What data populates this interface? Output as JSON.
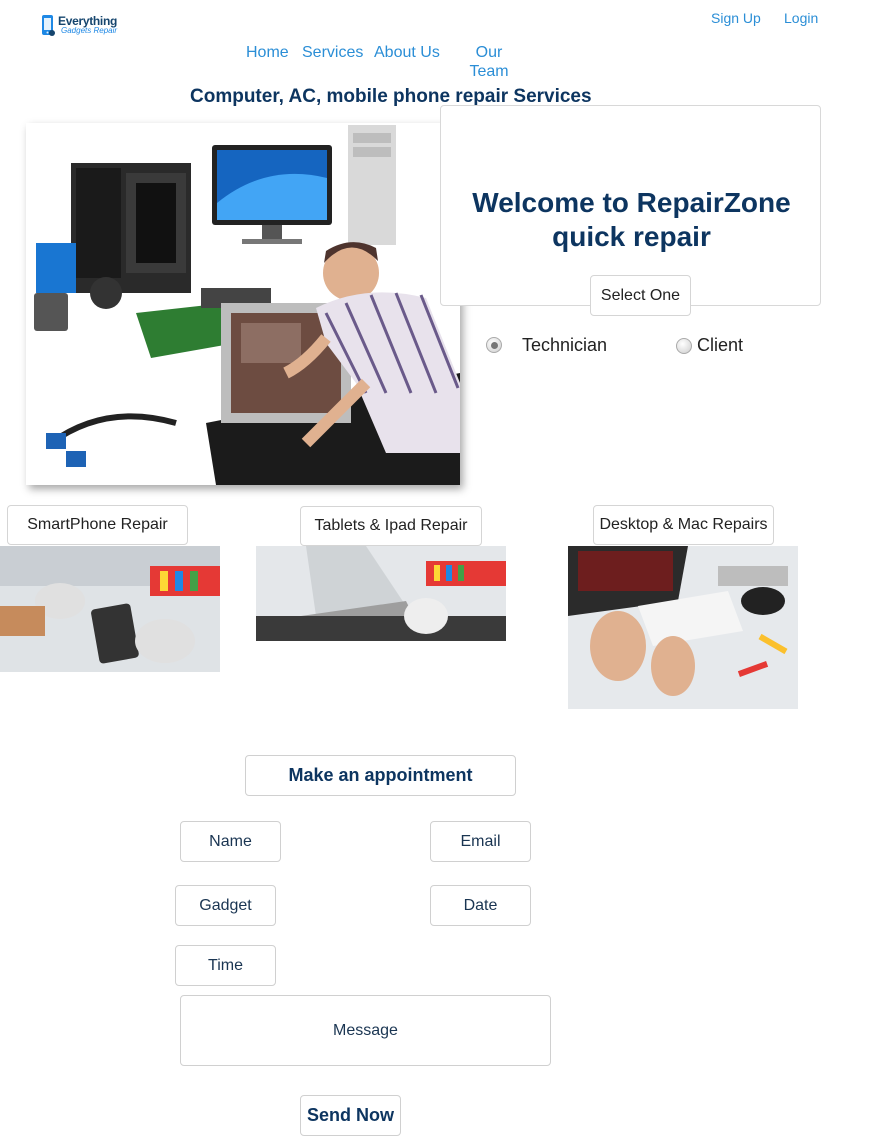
{
  "header": {
    "logo": {
      "line1": "Everything",
      "line2": "Gadgets Repair"
    },
    "signup_label": "Sign Up",
    "login_label": "Login"
  },
  "nav": {
    "home": "Home",
    "services": "Services",
    "about": "About Us",
    "team_line1": "Our",
    "team_line2": "Team"
  },
  "tagline": "Computer, AC, mobile phone repair Services",
  "welcome": {
    "title_line1": "Welcome to RepairZone",
    "title_line2": "quick repair",
    "select_label": "Select One",
    "options": [
      {
        "label": "Technician",
        "selected": true
      },
      {
        "label": "Client",
        "selected": false
      }
    ]
  },
  "services": [
    {
      "label": "SmartPhone Repair"
    },
    {
      "label": "Tablets & Ipad Repair"
    },
    {
      "label": "Desktop & Mac Repairs"
    }
  ],
  "appointment": {
    "heading": "Make an appointment",
    "fields": {
      "name": "Name",
      "email": "Email",
      "gadget": "Gadget",
      "date": "Date",
      "time": "Time",
      "message": "Message"
    },
    "submit_label": "Send Now"
  },
  "colors": {
    "link": "#2b8ed6",
    "heading": "#0d3560",
    "border": "#d5d5d5"
  }
}
